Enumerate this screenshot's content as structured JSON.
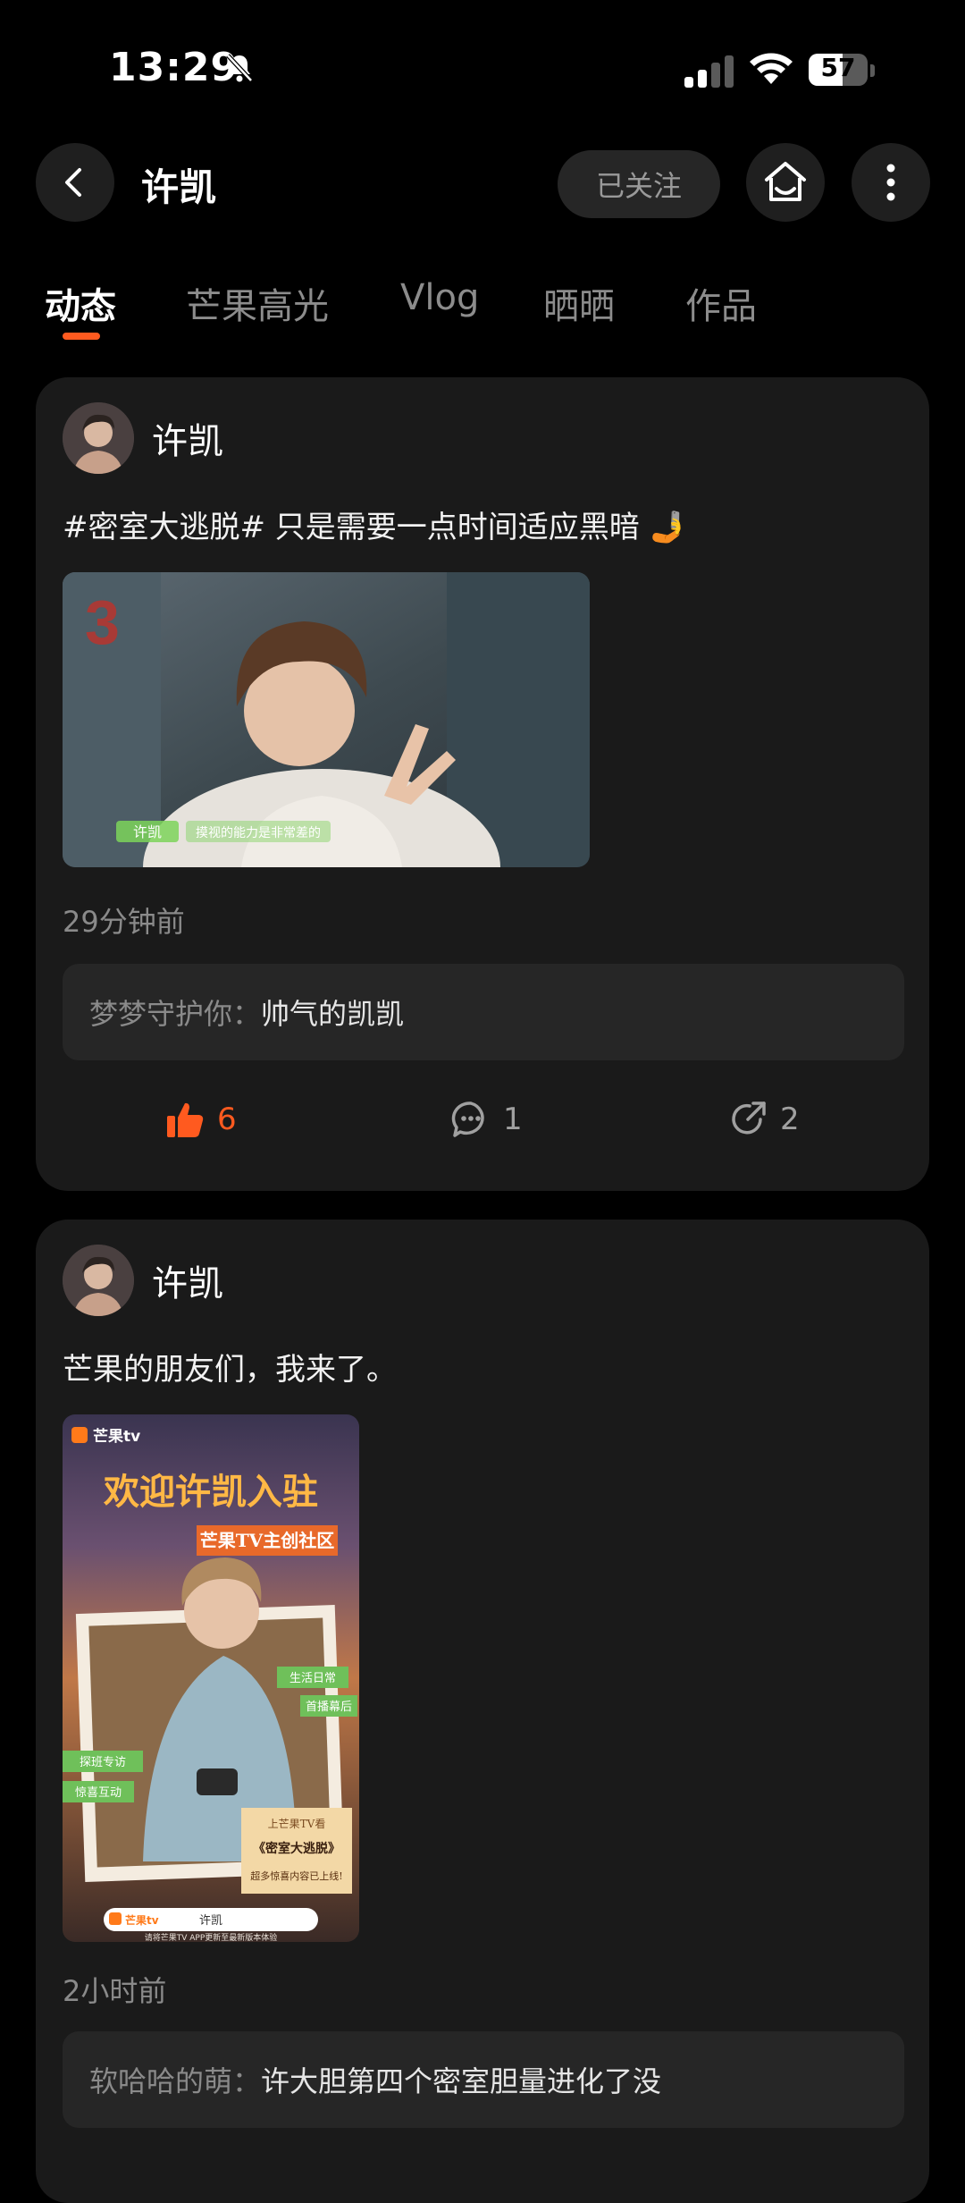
{
  "status_bar": {
    "time": "13:29",
    "battery": "57",
    "battery_level": 0.57
  },
  "header": {
    "title": "许凯",
    "follow_label": "已关注"
  },
  "tabs": [
    {
      "label": "动态",
      "active": true
    },
    {
      "label": "芒果高光",
      "active": false
    },
    {
      "label": "Vlog",
      "active": false
    },
    {
      "label": "晒晒",
      "active": false
    },
    {
      "label": "作品",
      "active": false
    }
  ],
  "posts": [
    {
      "author": "许凯",
      "text": "#密室大逃脱# 只是需要一点时间适应黑暗 🤳",
      "image_caption_name": "许凯",
      "image_caption_text": "摸视的能力是非常差的",
      "time": "29分钟前",
      "comment_user": "梦梦守护你：",
      "comment_text": "帅气的凯凯",
      "likes": "6",
      "comments": "1",
      "shares": "2"
    },
    {
      "author": "许凯",
      "text": "芒果的朋友们，我来了。",
      "poster": {
        "brand": "芒果tv",
        "headline": "欢迎许凯入驻",
        "subhead": "芒果TV主创社区",
        "tag_life": "生活日常",
        "tag_behind": "首播幕后",
        "tag_visit": "探班专访",
        "tag_interact": "惊喜互动",
        "card_title": "上芒果TV看",
        "card_show": "《密室大逃脱》",
        "card_more": "超多惊喜内容已上线!",
        "search_name": "许凯",
        "footer": "请将芒果TV APP更新至最新版本体验"
      },
      "time": "2小时前",
      "comment_user": "软哈哈的萌：",
      "comment_text": "许大胆第四个密室胆量进化了没"
    }
  ],
  "colors": {
    "accent": "#ff5a1f",
    "card": "#1a1a1a",
    "background": "#000000"
  }
}
